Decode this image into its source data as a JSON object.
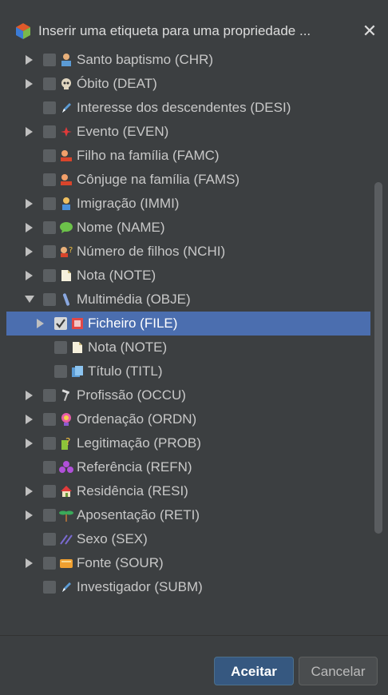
{
  "window": {
    "title": "Inserir uma etiqueta para uma propriedade ...",
    "close_icon": "close-icon",
    "app_icon": "gramps-cube-icon"
  },
  "tree": {
    "items": [
      {
        "label": "Santo baptismo (CHR)",
        "icon": "baptism-icon",
        "expandable": true,
        "expanded": false,
        "checked": false,
        "indent": 0
      },
      {
        "label": "Óbito (DEAT)",
        "icon": "skull-icon",
        "expandable": true,
        "expanded": false,
        "checked": false,
        "indent": 0
      },
      {
        "label": "Interesse dos descendentes (DESI)",
        "icon": "pen-icon",
        "expandable": false,
        "expanded": false,
        "checked": false,
        "indent": 0
      },
      {
        "label": "Evento (EVEN)",
        "icon": "event-icon",
        "expandable": true,
        "expanded": false,
        "checked": false,
        "indent": 0
      },
      {
        "label": "Filho na família (FAMC)",
        "icon": "family-icon",
        "expandable": false,
        "expanded": false,
        "checked": false,
        "indent": 0
      },
      {
        "label": "Cônjuge na família (FAMS)",
        "icon": "family-icon",
        "expandable": false,
        "expanded": false,
        "checked": false,
        "indent": 0
      },
      {
        "label": "Imigração (IMMI)",
        "icon": "person-icon",
        "expandable": true,
        "expanded": false,
        "checked": false,
        "indent": 0
      },
      {
        "label": "Nome (NAME)",
        "icon": "speech-bubble-icon",
        "expandable": true,
        "expanded": false,
        "checked": false,
        "indent": 0
      },
      {
        "label": "Número de filhos (NCHI)",
        "icon": "children-count-icon",
        "expandable": true,
        "expanded": false,
        "checked": false,
        "indent": 0
      },
      {
        "label": "Nota (NOTE)",
        "icon": "note-icon",
        "expandable": true,
        "expanded": false,
        "checked": false,
        "indent": 0
      },
      {
        "label": "Multimédia (OBJE)",
        "icon": "media-icon",
        "expandable": true,
        "expanded": true,
        "checked": false,
        "indent": 0
      },
      {
        "label": "Ficheiro (FILE)",
        "icon": "file-icon",
        "expandable": true,
        "expanded": false,
        "checked": true,
        "indent": 1,
        "selected": true
      },
      {
        "label": "Nota (NOTE)",
        "icon": "note-icon",
        "expandable": false,
        "expanded": false,
        "checked": false,
        "indent": 1
      },
      {
        "label": "Título (TITL)",
        "icon": "title-icon",
        "expandable": false,
        "expanded": false,
        "checked": false,
        "indent": 1
      },
      {
        "label": "Profissão (OCCU)",
        "icon": "hammer-icon",
        "expandable": true,
        "expanded": false,
        "checked": false,
        "indent": 0
      },
      {
        "label": "Ordenação (ORDN)",
        "icon": "ordination-icon",
        "expandable": true,
        "expanded": false,
        "checked": false,
        "indent": 0
      },
      {
        "label": "Legitimação (PROB)",
        "icon": "legitimation-icon",
        "expandable": true,
        "expanded": false,
        "checked": false,
        "indent": 0
      },
      {
        "label": "Referência (REFN)",
        "icon": "reference-icon",
        "expandable": false,
        "expanded": false,
        "checked": false,
        "indent": 0
      },
      {
        "label": "Residência (RESI)",
        "icon": "house-icon",
        "expandable": true,
        "expanded": false,
        "checked": false,
        "indent": 0
      },
      {
        "label": "Aposentação (RETI)",
        "icon": "palm-tree-icon",
        "expandable": true,
        "expanded": false,
        "checked": false,
        "indent": 0
      },
      {
        "label": "Sexo (SEX)",
        "icon": "gender-icon",
        "expandable": false,
        "expanded": false,
        "checked": false,
        "indent": 0
      },
      {
        "label": "Fonte (SOUR)",
        "icon": "source-icon",
        "expandable": true,
        "expanded": false,
        "checked": false,
        "indent": 0
      },
      {
        "label": "Investigador (SUBM)",
        "icon": "pen-icon",
        "expandable": false,
        "expanded": false,
        "checked": false,
        "indent": 0
      }
    ]
  },
  "buttons": {
    "accept_label": "Aceitar",
    "cancel_label": "Cancelar"
  },
  "colors": {
    "background": "#3c3f41",
    "selection": "#4b6eaf",
    "primary_button": "#365880"
  }
}
